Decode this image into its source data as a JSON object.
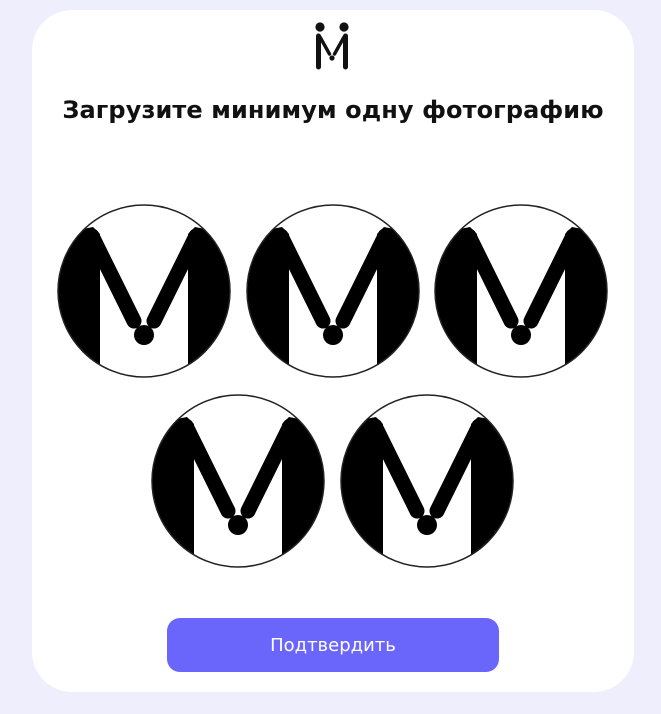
{
  "brand": {
    "logo_icon": "m-logo-icon"
  },
  "title": "Загрузите минимум одну фотографию",
  "photos": [
    {
      "state": "placeholder",
      "icon": "m-logo-icon"
    },
    {
      "state": "placeholder",
      "icon": "m-logo-icon"
    },
    {
      "state": "placeholder",
      "icon": "m-logo-icon"
    },
    {
      "state": "placeholder",
      "icon": "m-logo-icon"
    },
    {
      "state": "placeholder",
      "icon": "m-logo-icon"
    }
  ],
  "confirm_button": {
    "label": "Подтвердить"
  },
  "colors": {
    "page_background": "#eeeefc",
    "card_background": "#ffffff",
    "accent": "#6b66fb",
    "title_text": "#111111",
    "button_text": "#ffffff"
  }
}
